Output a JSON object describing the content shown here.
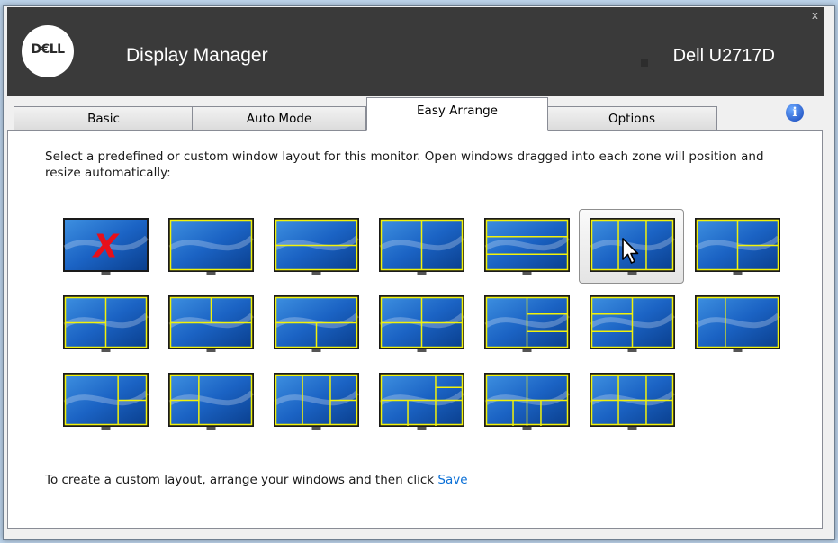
{
  "window": {
    "close_label": "x"
  },
  "header": {
    "logo_text": "D€LL",
    "app_title": "Display Manager",
    "monitor_name": "Dell U2717D"
  },
  "tabs": [
    {
      "label": "Basic",
      "active": false
    },
    {
      "label": "Auto Mode",
      "active": false
    },
    {
      "label": "Easy Arrange",
      "active": true
    },
    {
      "label": "Options",
      "active": false
    }
  ],
  "info_icon": {
    "glyph": "i",
    "name": "info-icon"
  },
  "main": {
    "instructions": "Select a predefined or custom window layout for this monitor. Open windows dragged into each zone will position and resize automatically:",
    "footer_text": "To create a custom layout, arrange your windows and then click ",
    "save_link": "Save"
  },
  "colors": {
    "title_bar": "#3a3a3a",
    "zone_border": "#f2f20a",
    "screen_blue": "#1b63c4",
    "link": "#0a6fd6",
    "disable_x": "#e8101a"
  },
  "layouts": {
    "selected_index": 5,
    "items": [
      {
        "name": "layout-none",
        "type": "none"
      },
      {
        "name": "layout-full",
        "type": "full"
      },
      {
        "name": "layout-2-horizontal",
        "type": "h2"
      },
      {
        "name": "layout-2-vertical",
        "type": "v2"
      },
      {
        "name": "layout-3-horizontal",
        "type": "h3"
      },
      {
        "name": "layout-3-vertical",
        "type": "v3"
      },
      {
        "name": "layout-left-large-right-2",
        "type": "l_r2"
      },
      {
        "name": "layout-left-2-right-large",
        "type": "l2_r"
      },
      {
        "name": "layout-top-2-bottom-large",
        "type": "t2_b"
      },
      {
        "name": "layout-top-large-bottom-2",
        "type": "t_b2"
      },
      {
        "name": "layout-4-grid",
        "type": "g4"
      },
      {
        "name": "layout-left-large-right-3",
        "type": "l_r3"
      },
      {
        "name": "layout-left-3-right-large",
        "type": "l3_r"
      },
      {
        "name": "layout-wide-left-right",
        "type": "wide_lr"
      },
      {
        "name": "layout-left-large-right-narrow-2",
        "type": "l_rn2"
      },
      {
        "name": "layout-narrow-left-2-right-large",
        "type": "ln2_r"
      },
      {
        "name": "layout-narrow-left-mid-right-2",
        "type": "ln_m_r2"
      },
      {
        "name": "layout-grid-5",
        "type": "g5"
      },
      {
        "name": "layout-grid-6",
        "type": "g6"
      },
      {
        "name": "layout-grid-4-wide",
        "type": "g4w"
      }
    ]
  }
}
